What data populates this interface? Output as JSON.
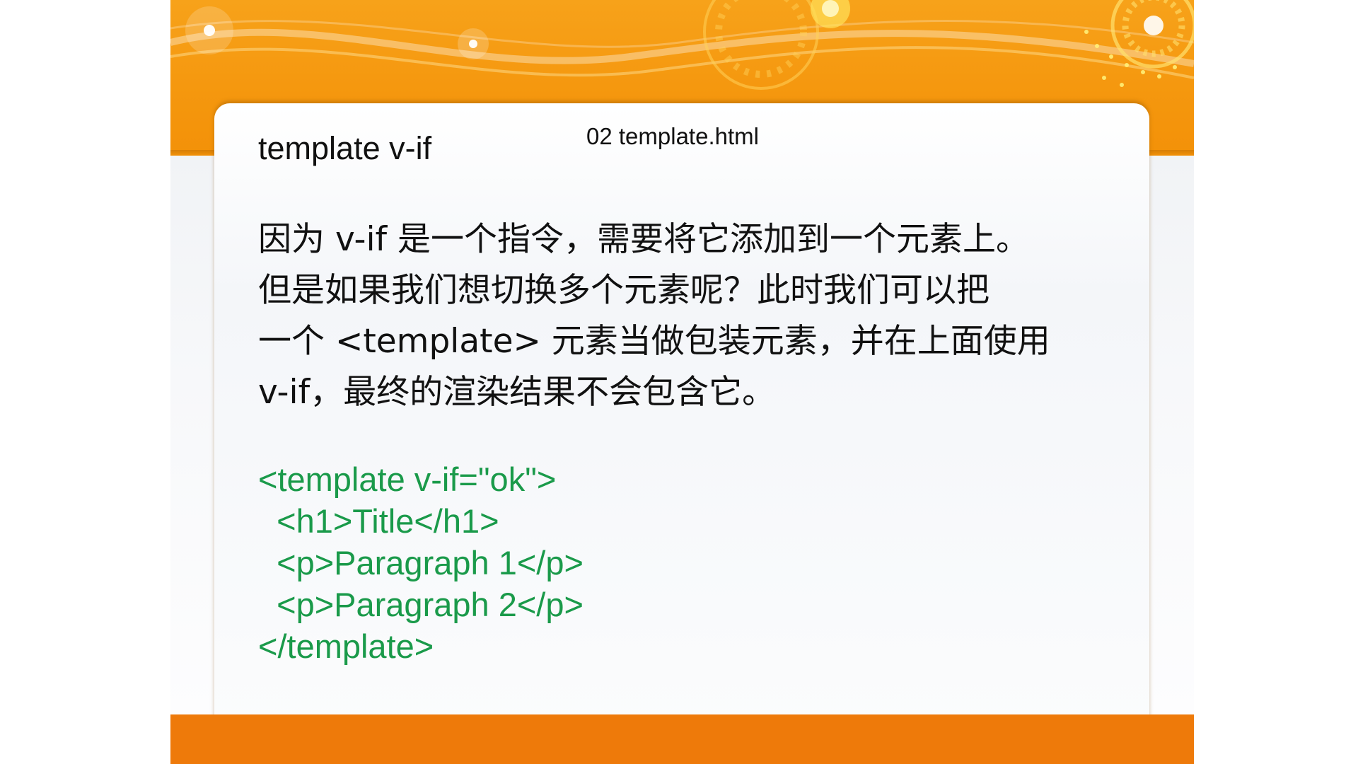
{
  "slide": {
    "title": "template v-if",
    "filename": "02 template.html",
    "body_lines": [
      "因为 v-if 是一个指令，需要将它添加到一个元素上。",
      "但是如果我们想切换多个元素呢？此时我们可以把",
      "一个 <template> 元素当做包装元素，并在上面使用",
      "v-if，最终的渲染结果不会包含它。"
    ],
    "code_lines": [
      "<template v-if=\"ok\">",
      "  <h1>Title</h1>",
      "  <p>Paragraph 1</p>",
      "  <p>Paragraph 2</p>",
      "</template>"
    ]
  },
  "colors": {
    "header_orange": "#f5980f",
    "footer_orange": "#ee7a0a",
    "code_green": "#1a9a4a",
    "text_black": "#111111"
  }
}
